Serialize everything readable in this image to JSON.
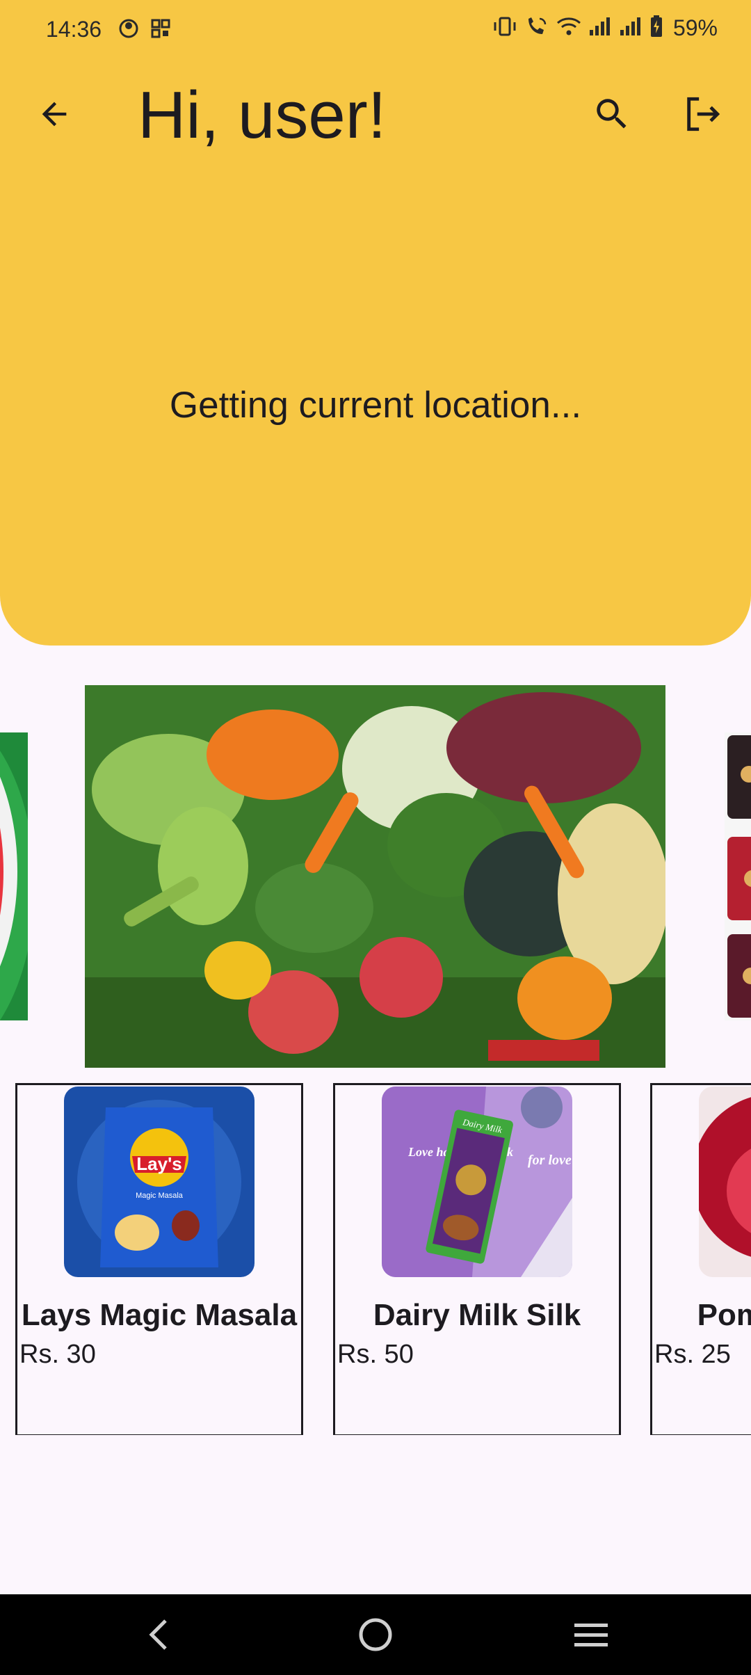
{
  "status_bar": {
    "time": "14:36",
    "battery": "59%",
    "icons": [
      "face-icon",
      "qr-icon",
      "vibrate-icon",
      "wifi-call-icon",
      "wifi-icon",
      "signal-icon",
      "signal-icon",
      "battery-charging-icon"
    ]
  },
  "app_bar": {
    "title": "Hi, user!",
    "back_icon": "arrow-back-icon",
    "search_icon": "search-icon",
    "logout_icon": "logout-icon"
  },
  "location": {
    "status_text": "Getting current location..."
  },
  "carousel": {
    "slides": [
      "watermelon",
      "vegetables",
      "snack-packs"
    ],
    "active_index": 1
  },
  "products": [
    {
      "name": "Lays Magic Masala",
      "price": "Rs. 30"
    },
    {
      "name": "Dairy Milk Silk",
      "price": "Rs. 50"
    },
    {
      "name": "Pomegranate",
      "price": "Rs. 25"
    }
  ],
  "product_images": {
    "lays_brand": "Lay's",
    "lays_flavor": "Magic Masala",
    "silk_tagline": "Love has a new look",
    "silk_brand": "Dairy Milk",
    "silk_for": "for love"
  },
  "colors": {
    "accent": "#f7c744",
    "background": "#fcf6fd",
    "text": "#1d1b20"
  },
  "nav_bar": {
    "icons": [
      "nav-back-icon",
      "home-icon",
      "recents-icon"
    ]
  }
}
